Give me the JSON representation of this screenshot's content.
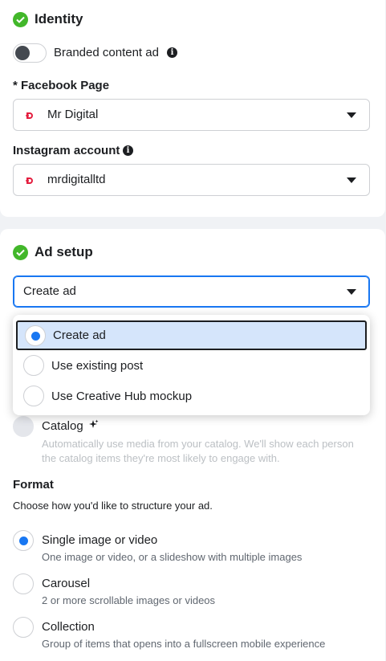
{
  "identity": {
    "title": "Identity",
    "branded_label": "Branded content ad",
    "facebook_page_label": "* Facebook Page",
    "facebook_page_value": "Mr Digital",
    "instagram_label": "Instagram account",
    "instagram_value": "mrdigitalltd"
  },
  "ad_setup": {
    "title": "Ad setup",
    "select_value": "Create ad",
    "options": [
      {
        "label": "Create ad",
        "selected": true
      },
      {
        "label": "Use existing post",
        "selected": false
      },
      {
        "label": "Use Creative Hub mockup",
        "selected": false
      }
    ],
    "catalog": {
      "label": "Catalog",
      "desc_line1": "Automatically use media from your catalog. We'll show each person",
      "desc_line2": "the catalog items they're most likely to engage with."
    },
    "format": {
      "title": "Format",
      "subtitle": "Choose how you'd like to structure your ad.",
      "options": [
        {
          "title": "Single image or video",
          "desc": "One image or video, or a slideshow with multiple images",
          "selected": true
        },
        {
          "title": "Carousel",
          "desc": "2 or more scrollable images or videos",
          "selected": false
        },
        {
          "title": "Collection",
          "desc": "Group of items that opens into a fullscreen mobile experience",
          "selected": false
        }
      ]
    }
  },
  "colors": {
    "accent": "#1877f2",
    "check": "#42b72a",
    "brand_logo": "#e41e3f"
  }
}
